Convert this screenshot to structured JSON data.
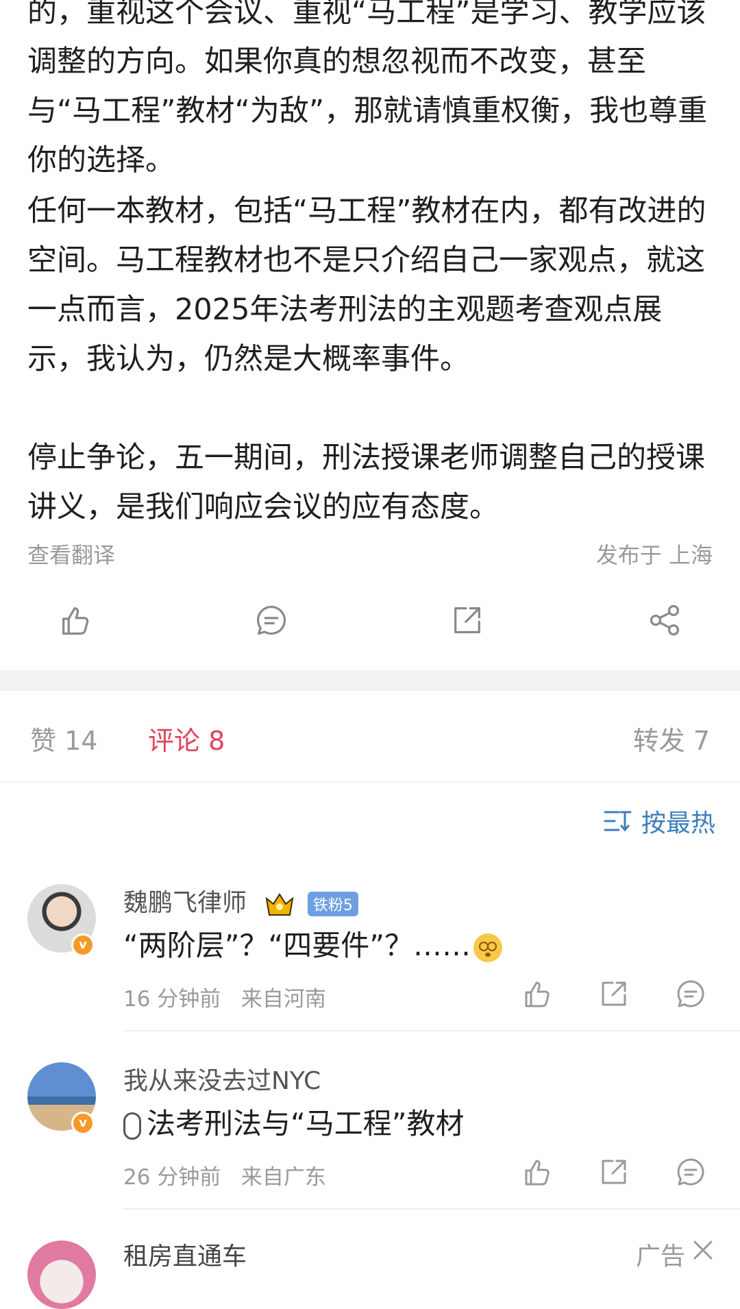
{
  "article": {
    "paragraph1": "的，重视这个会议、重视“马工程”是学习、教学应该调整的方向。如果你真的想忽视而不改变，甚至与“马工程”教材“为敌”，那就请慎重权衡，我也尊重你的选择。",
    "paragraph2": "任何一本教材，包括“马工程”教材在内，都有改进的空间。马工程教材也不是只介绍自己一家观点，就这一点而言，2025年法考刑法的主观题考查观点展示，我认为，仍然是大概率事件。",
    "paragraph3": "停止争论，五一期间，刑法授课老师调整自己的授课讲义，是我们响应会议的应有态度。",
    "translate_link": "查看翻译",
    "location": "发布于 上海"
  },
  "actions": {
    "like_icon": "thumbs-up-icon",
    "comment_icon": "comment-icon",
    "repost_icon": "repost-icon",
    "share_icon": "share-icon"
  },
  "tabs": {
    "likes": "赞 14",
    "comments": "评论 8",
    "reposts": "转发 7"
  },
  "sort": {
    "label": "按最热",
    "icon": "sort-icon"
  },
  "comments": [
    {
      "name": "魏鹏飞律师",
      "fan_badge": "铁粉5",
      "text": "“两阶层”？“四要件”？……",
      "time": "16 分钟前",
      "from": "来自河南"
    },
    {
      "name": "我从来没去过NYC",
      "text": "法考刑法与“马工程”教材",
      "time": "26 分钟前",
      "from": "来自广东"
    },
    {
      "name": "租房直通车",
      "ad_label": "广告"
    }
  ],
  "colors": {
    "accent_red": "#e0445b",
    "accent_blue": "#3d7ebd",
    "muted": "#9a9a9a"
  }
}
